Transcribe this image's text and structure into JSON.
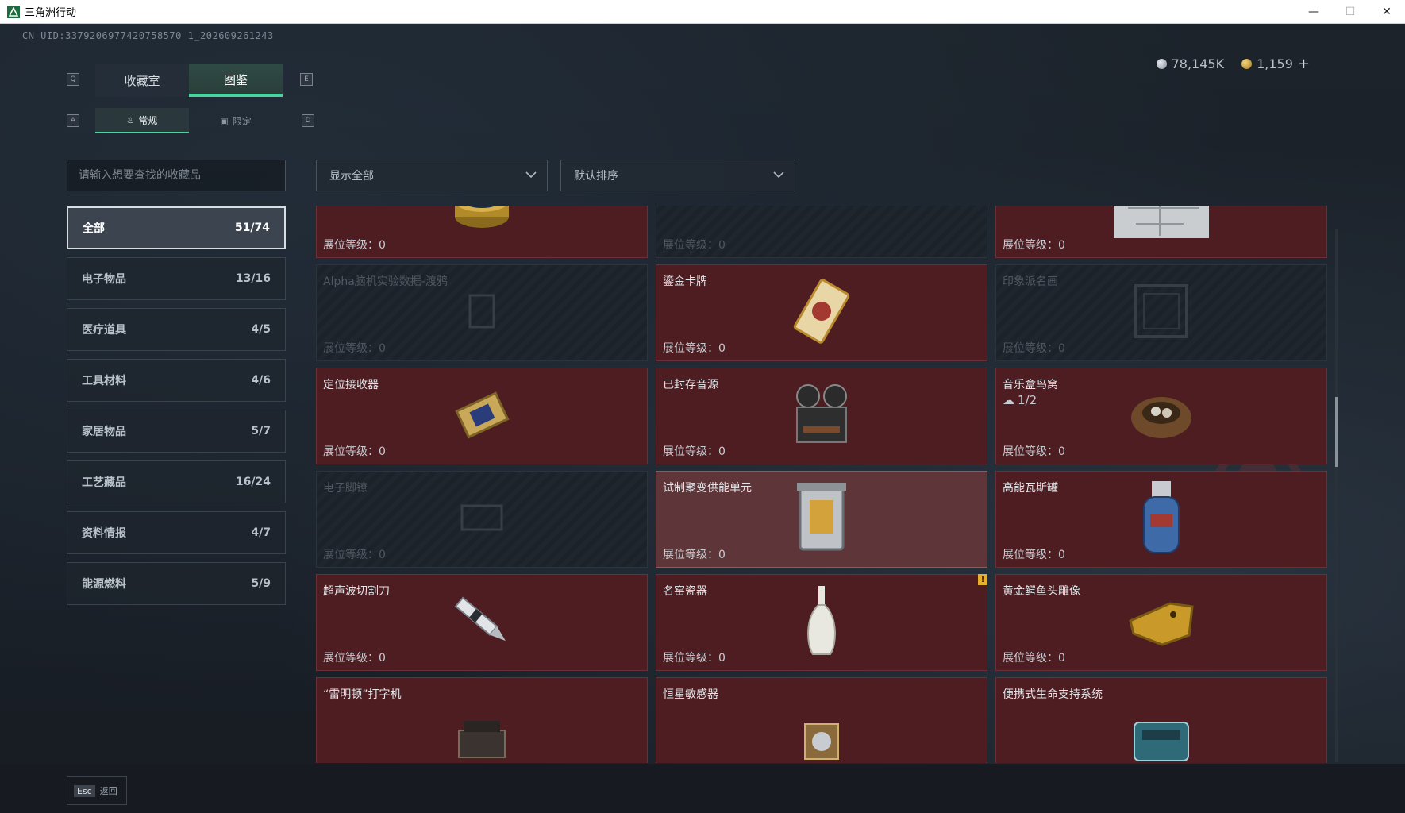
{
  "window": {
    "title": "三角洲行动",
    "minimize": "—",
    "maximize": "☐",
    "close": "✕"
  },
  "uid": "CN UID:3379206977420758570 1_202609261243",
  "currency": {
    "silver": "78,145K",
    "gold": "1,159",
    "plus": "+"
  },
  "keys": {
    "q": "Q",
    "e": "E",
    "a": "A",
    "d": "D"
  },
  "tabs_top": [
    {
      "label": "收藏室"
    },
    {
      "label": "图鉴"
    }
  ],
  "tabs_sub": [
    {
      "label": "常规",
      "icon": "flame-icon"
    },
    {
      "label": "限定",
      "icon": "image-icon"
    }
  ],
  "search": {
    "placeholder": "请输入想要查找的收藏品"
  },
  "filters": {
    "show": "显示全部",
    "sort": "默认排序"
  },
  "categories": [
    {
      "label": "全部",
      "count": "51/74"
    },
    {
      "label": "电子物品",
      "count": "13/16"
    },
    {
      "label": "医疗道具",
      "count": "4/5"
    },
    {
      "label": "工具材料",
      "count": "4/6"
    },
    {
      "label": "家居物品",
      "count": "5/7"
    },
    {
      "label": "工艺藏品",
      "count": "16/24"
    },
    {
      "label": "资料情报",
      "count": "4/7"
    },
    {
      "label": "能源燃料",
      "count": "5/9"
    }
  ],
  "level_prefix": "展位等级：",
  "cards": [
    {
      "name": "",
      "level": "0",
      "state": "owned",
      "icon": "caviar-tin-icon"
    },
    {
      "name": "",
      "level": "0",
      "state": "locked",
      "icon": "unknown-item-icon"
    },
    {
      "name": "",
      "level": "0",
      "state": "owned",
      "icon": "map-document-icon"
    },
    {
      "name": "Alpha脑机实验数据-渡鸦",
      "level": "0",
      "state": "locked",
      "icon": "data-drive-icon"
    },
    {
      "name": "鎏金卡牌",
      "level": "0",
      "state": "owned",
      "icon": "gilded-card-icon"
    },
    {
      "name": "印象派名画",
      "level": "0",
      "state": "locked",
      "icon": "painting-frame-icon"
    },
    {
      "name": "定位接收器",
      "level": "0",
      "state": "owned",
      "icon": "locator-receiver-icon"
    },
    {
      "name": "已封存音源",
      "level": "0",
      "state": "owned",
      "icon": "reel-tape-recorder-icon"
    },
    {
      "name": "音乐盒鸟窝",
      "level": "0",
      "state": "owned",
      "icon": "bird-nest-music-box-icon",
      "sub": "1/2"
    },
    {
      "name": "电子脚镣",
      "level": "0",
      "state": "locked",
      "icon": "ankle-monitor-icon"
    },
    {
      "name": "试制聚变供能单元",
      "level": "0",
      "state": "highlight",
      "icon": "fusion-cell-icon"
    },
    {
      "name": "高能瓦斯罐",
      "level": "0",
      "state": "owned",
      "icon": "gas-canister-icon"
    },
    {
      "name": "超声波切割刀",
      "level": "0",
      "state": "owned",
      "icon": "ultrasonic-knife-icon"
    },
    {
      "name": "名窑瓷器",
      "level": "0",
      "state": "owned",
      "icon": "porcelain-vase-icon",
      "warn": "!"
    },
    {
      "name": "黄金鳄鱼头雕像",
      "level": "0",
      "state": "owned",
      "icon": "golden-crocodile-icon"
    },
    {
      "name": "“雷明顿”打字机",
      "level": "",
      "state": "owned",
      "icon": "typewriter-icon"
    },
    {
      "name": "恒星敏感器",
      "level": "",
      "state": "owned",
      "icon": "star-sensor-icon"
    },
    {
      "name": "便携式生命支持系统",
      "level": "",
      "state": "owned",
      "icon": "life-support-icon"
    }
  ],
  "bottom": {
    "esc_key": "Esc",
    "esc_label": "返回"
  },
  "colors": {
    "accent": "#4bd4a0",
    "card_owned": "#4d1d22",
    "card_highlight": "#5e3538",
    "warning": "#e8b02a"
  }
}
